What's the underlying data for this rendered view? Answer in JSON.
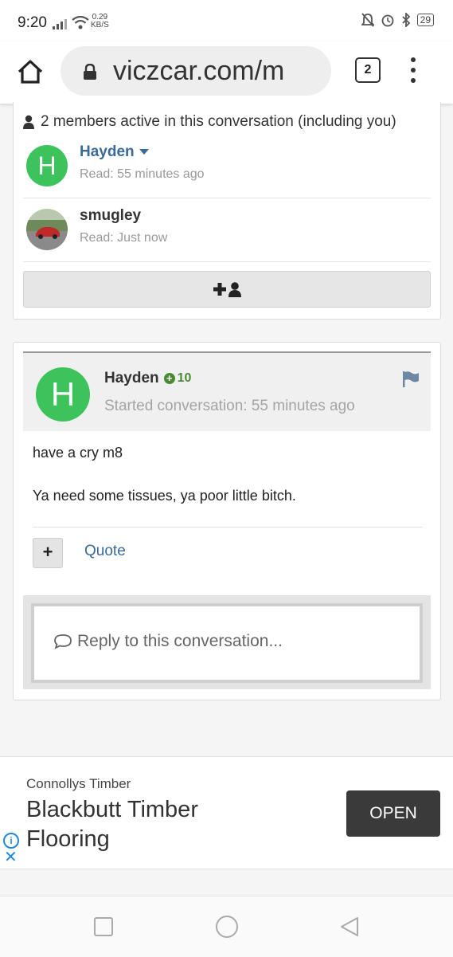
{
  "status_bar": {
    "time": "9:20",
    "net_speed": "0.29",
    "net_unit": "KB/S",
    "battery": "29"
  },
  "browser": {
    "url": "viczcar.com/m",
    "tab_count": "2"
  },
  "members": {
    "heading": "2 members active in this conversation (including you)",
    "list": [
      {
        "name": "Hayden",
        "avatar_letter": "H",
        "read": "Read: 55 minutes ago",
        "name_color": "#3a6a9a"
      },
      {
        "name": "smugley",
        "read": "Read: Just now",
        "name_color": "#333333"
      }
    ]
  },
  "message": {
    "avatar_letter": "H",
    "author": "Hayden",
    "reputation": "10",
    "started": "Started conversation: 55 minutes ago",
    "body": [
      "have a cry m8",
      "Ya need some tissues, ya poor little bitch."
    ],
    "quote_label": "Quote"
  },
  "reply": {
    "placeholder": "Reply to this conversation..."
  },
  "ad": {
    "advertiser": "Connollys Timber",
    "title": "Blackbutt Timber Flooring",
    "cta": "OPEN"
  },
  "colors": {
    "avatar_green": "#3cc35c",
    "link_blue": "#3a6a9a",
    "rep_green": "#4a8a34",
    "ad_button": "#3a3a3a"
  }
}
